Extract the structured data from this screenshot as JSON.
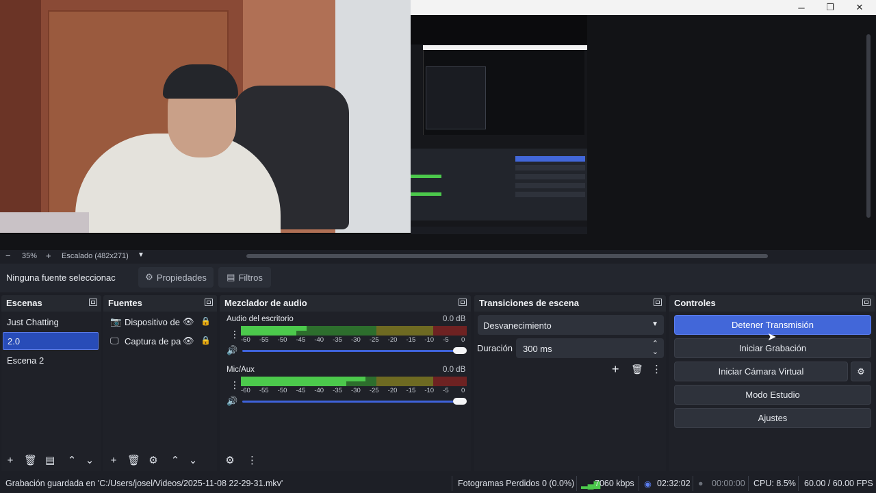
{
  "window": {
    "minimize_icon": "minimize-icon",
    "maximize_icon": "restore-icon",
    "close_icon": "close-icon"
  },
  "zoom": {
    "minus": "−",
    "level": "35%",
    "plus": "+",
    "scaling": "Escalado (482x271)"
  },
  "source_toolbar": {
    "no_source": "Ninguna fuente seleccionac",
    "properties": "Propiedades",
    "filters": "Filtros"
  },
  "scenes": {
    "title": "Escenas",
    "items": [
      {
        "label": "Just Chatting"
      },
      {
        "label": "2.0"
      },
      {
        "label": "Escena 2"
      }
    ]
  },
  "sources": {
    "title": "Fuentes",
    "items": [
      {
        "label": "Dispositivo de"
      },
      {
        "label": "Captura de pa"
      }
    ]
  },
  "mixer": {
    "title": "Mezclador de audio",
    "channels": [
      {
        "name": "Audio del escritorio",
        "db": "0.0 dB",
        "level": 0.29
      },
      {
        "name": "Mic/Aux",
        "db": "0.0 dB",
        "level": 0.55
      }
    ],
    "scale": [
      "-60",
      "-55",
      "-50",
      "-45",
      "-40",
      "-35",
      "-30",
      "-25",
      "-20",
      "-15",
      "-10",
      "-5",
      "0"
    ]
  },
  "transitions": {
    "title": "Transiciones de escena",
    "selected": "Desvanecimiento",
    "duration_label": "Duración",
    "duration_value": "300 ms"
  },
  "controls": {
    "title": "Controles",
    "stop_stream": "Detener Transmisión",
    "start_recording": "Iniciar Grabación",
    "start_virtual_cam": "Iniciar Cámara Virtual",
    "studio_mode": "Modo Estudio",
    "settings": "Ajustes"
  },
  "status": {
    "recording_saved": "Grabación guardada en 'C:/Users/josel/Videos/2025-11-08 22-29-31.mkv'",
    "dropped_frames": "Fotogramas Perdidos 0 (0.0%)",
    "bitrate": "7060 kbps",
    "stream_time": "02:32:02",
    "record_time": "00:00:00",
    "cpu": "CPU: 8.5%",
    "fps": "60.00 / 60.00 FPS"
  },
  "colors": {
    "accent": "#4267d9",
    "selected": "#284cb8",
    "meter_green": "#4cc94c",
    "meter_yellow": "#c9c23a",
    "meter_red": "#c93a3a"
  }
}
